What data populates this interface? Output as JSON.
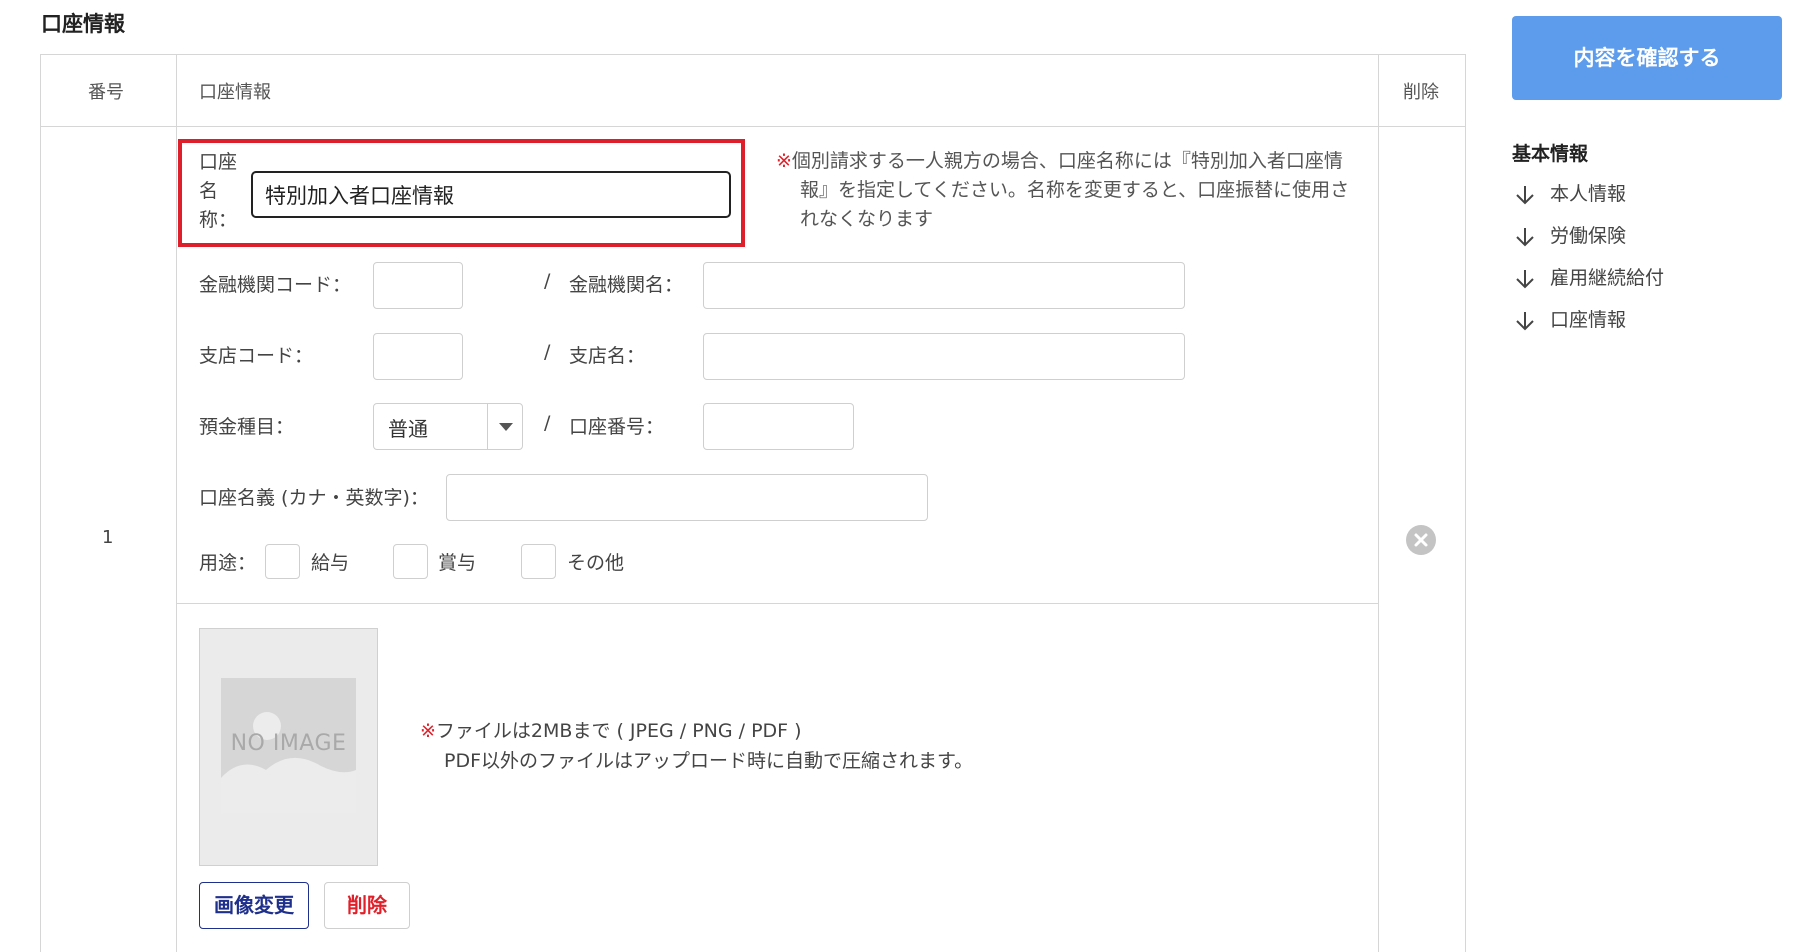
{
  "section_title": "口座情報",
  "table": {
    "headers": {
      "number": "番号",
      "account_info": "口座情報",
      "delete": "削除"
    },
    "row": {
      "number": "1",
      "account_name": {
        "label_chars": [
          "口座",
          "名",
          "称："
        ],
        "value": "特別加入者口座情報"
      },
      "note": {
        "mark": "※",
        "text": "個別請求する一人親方の場合、口座名称には『特別加入者口座情報』を指定してください。名称を変更すると、口座振替に使用されなくなります"
      },
      "bank_code_label": "金融機関コード：",
      "bank_name_label": "金融機関名：",
      "branch_code_label": "支店コード：",
      "branch_name_label": "支店名：",
      "deposit_type_label": "預金種目：",
      "deposit_type_value": "普通",
      "account_number_label": "口座番号：",
      "account_holder_label": "口座名義 (カナ・英数字)：",
      "slash": "/",
      "purpose_label": "用途：",
      "purposes": [
        "給与",
        "賞与",
        "その他"
      ],
      "image": {
        "placeholder": "NO IMAGE",
        "note_mark": "※",
        "note_line1": "ファイルは2MBまで ( JPEG / PNG / PDF )",
        "note_line2": "PDF以外のファイルはアップロード時に自動で圧縮されます。",
        "change_button": "画像変更",
        "delete_button": "削除"
      }
    }
  },
  "sidebar": {
    "confirm_button": "内容を確認する",
    "nav_title": "基本情報",
    "nav_items": [
      "本人情報",
      "労働保険",
      "雇用継続給付",
      "口座情報"
    ]
  },
  "colors": {
    "primary_button": "#5d9cec",
    "highlight_border": "#dd1f2c",
    "note_mark": "#e2202a",
    "change_button": "#1e2f8c"
  }
}
